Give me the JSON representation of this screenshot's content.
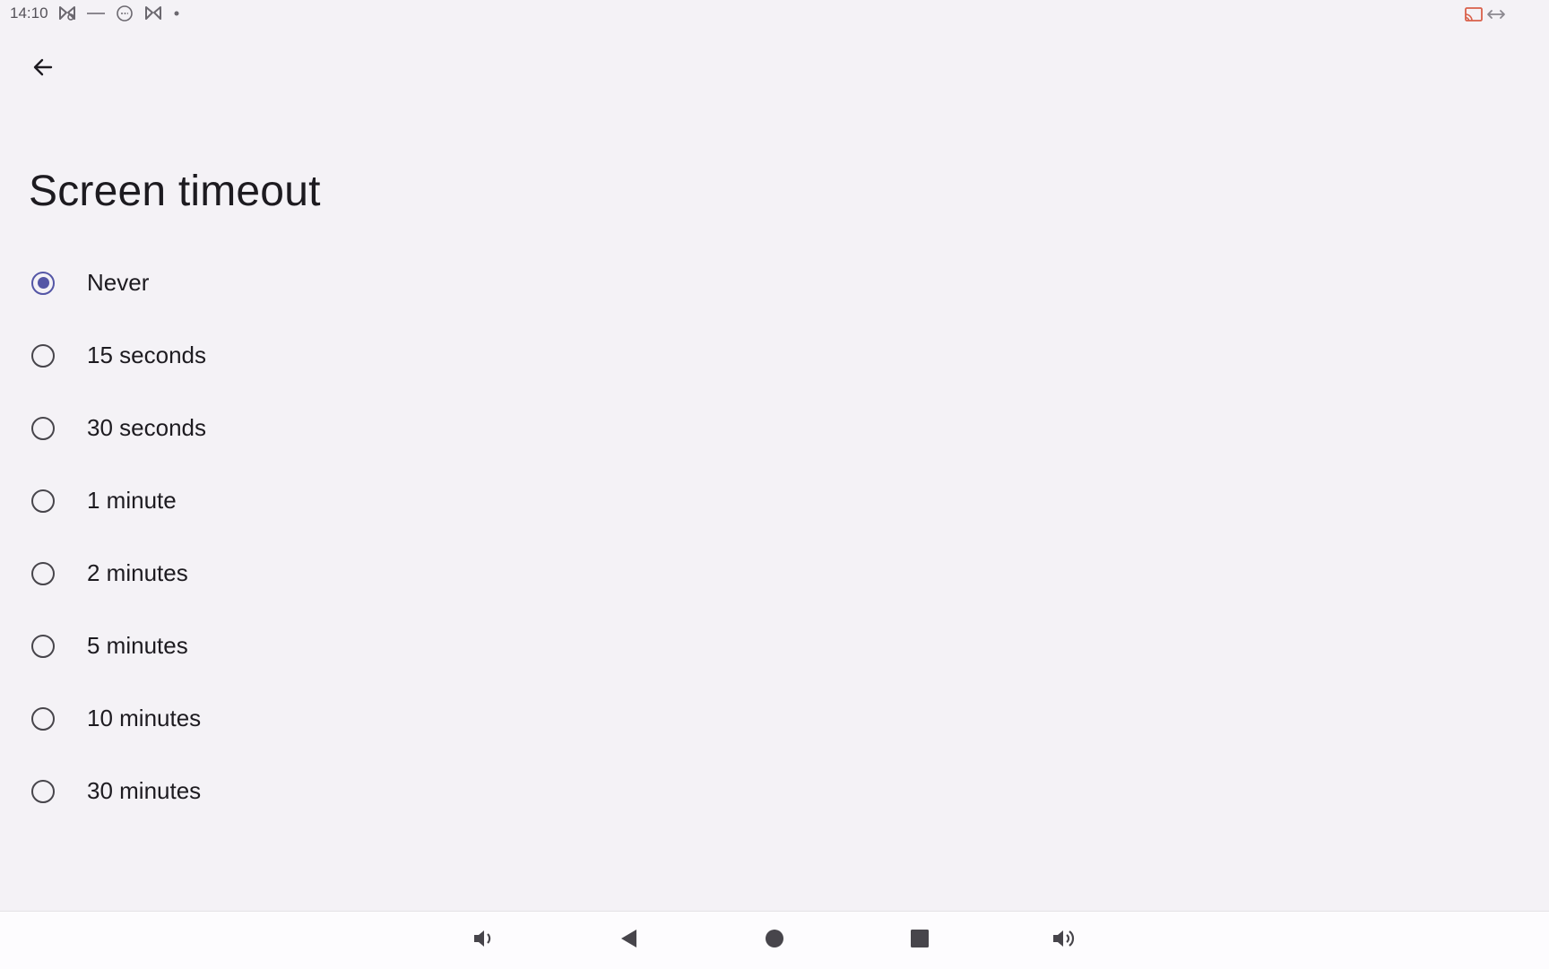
{
  "status_bar": {
    "time": "14:10",
    "left_icons": [
      "notification-app-icon",
      "minus-icon",
      "chat-bubble-icon",
      "notification-app-icon",
      "dot-icon"
    ],
    "right_icons": [
      "cast-icon",
      "resize-arrows-icon"
    ]
  },
  "header": {
    "back_icon": "arrow-left-icon",
    "title": "Screen timeout"
  },
  "options": [
    {
      "label": "Never",
      "selected": true
    },
    {
      "label": "15 seconds",
      "selected": false
    },
    {
      "label": "30 seconds",
      "selected": false
    },
    {
      "label": "1 minute",
      "selected": false
    },
    {
      "label": "2 minutes",
      "selected": false
    },
    {
      "label": "5 minutes",
      "selected": false
    },
    {
      "label": "10 minutes",
      "selected": false
    },
    {
      "label": "30 minutes",
      "selected": false
    }
  ],
  "nav_bar": {
    "buttons": [
      "volume-down-icon",
      "back-triangle-icon",
      "home-circle-icon",
      "recents-square-icon",
      "volume-up-icon"
    ]
  },
  "colors": {
    "background": "#f4f2f6",
    "accent": "#5456a6",
    "text": "#1d1b20",
    "nav_background": "#fdfcfe"
  }
}
